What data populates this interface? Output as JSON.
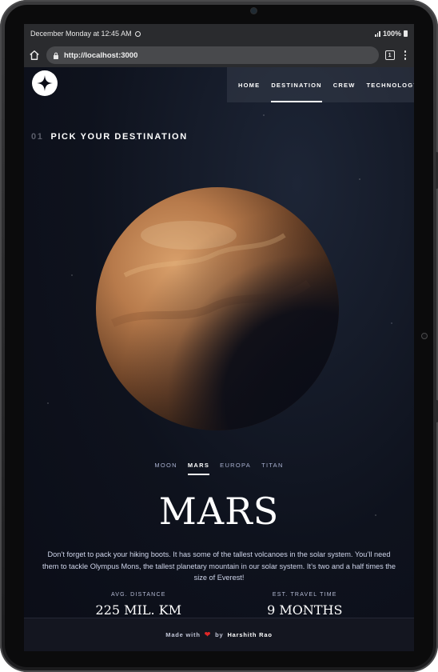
{
  "status_bar": {
    "time": "December Monday at 12:45 AM",
    "battery": "100%"
  },
  "browser": {
    "url": "http://localhost:3000",
    "tab_count": "1"
  },
  "nav": {
    "items": [
      {
        "label": "HOME"
      },
      {
        "label": "DESTINATION"
      },
      {
        "label": "CREW"
      },
      {
        "label": "TECHNOLOGY"
      }
    ],
    "active_index": 1
  },
  "heading": {
    "number": "01",
    "text": "PICK YOUR DESTINATION"
  },
  "destinations": {
    "tabs": [
      "MOON",
      "MARS",
      "EUROPA",
      "TITAN"
    ],
    "active_index": 1
  },
  "planet": {
    "name": "MARS",
    "description": "Don’t forget to pack your hiking boots. It has some of the tallest volcanoes in the solar system. You’ll need them to tackle Olympus Mons, the tallest planetary mountain in our solar system. It’s two and a half times the size of Everest!",
    "distance_label": "AVG. DISTANCE",
    "distance_value": "225 MIL. KM",
    "travel_label": "EST. TRAVEL TIME",
    "travel_value": "9 MONTHS"
  },
  "footer": {
    "made_with": "Made with",
    "by": "by",
    "author": "Harshith Rao"
  },
  "colors": {
    "background": "#0b0d17",
    "accent": "#ffffff",
    "heart": "#e02727"
  },
  "icons": [
    "home-icon",
    "lock-icon",
    "tabs-icon",
    "menu-icon",
    "wifi-icon",
    "signal-icon",
    "battery-icon",
    "logo-star-icon",
    "heart-icon"
  ]
}
